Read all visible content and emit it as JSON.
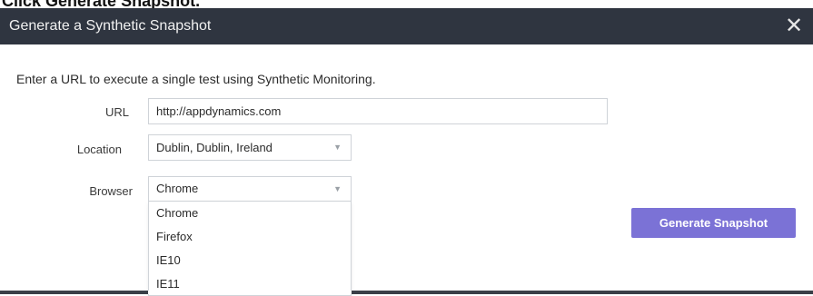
{
  "page_caption": "Click Generate Snapshot.",
  "dialog": {
    "title": "Generate a Synthetic Snapshot",
    "close_glyph": "✕",
    "intro": "Enter a URL to execute a single test using Synthetic Monitoring.",
    "url": {
      "label": "URL",
      "value": "http://appdynamics.com"
    },
    "location": {
      "label": "Location",
      "value": "Dublin, Dublin, Ireland"
    },
    "browser": {
      "label": "Browser",
      "value": "Chrome",
      "options": [
        "Chrome",
        "Firefox",
        "IE10",
        "IE11"
      ]
    },
    "generate_button": "Generate Snapshot"
  },
  "icons": {
    "close": "close-icon",
    "caret": "chevron-down-icon"
  },
  "colors": {
    "titlebar": "#2f3540",
    "primary_button": "#7b72d6",
    "border": "#cfd3d8"
  }
}
